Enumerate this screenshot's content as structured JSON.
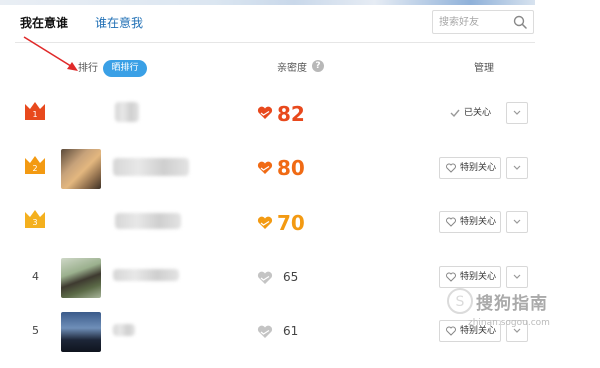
{
  "tabs": {
    "active": "我在意谁",
    "inactive": "谁在意我"
  },
  "search": {
    "placeholder": "搜索好友"
  },
  "header": {
    "rank_label": "排行",
    "rank_button": "晒排行",
    "intimacy_label": "亲密度",
    "manage_label": "管理"
  },
  "colors": {
    "gold": "#f39a12",
    "orange_red": "#e8491d",
    "blue": "#3aa0e6",
    "orange": "#f06a14"
  },
  "rows": [
    {
      "rank": "1",
      "score": "82",
      "score_color": "#e8491d",
      "action": "已关心",
      "icon": "crown-icon"
    },
    {
      "rank": "2",
      "score": "80",
      "score_color": "#f06a14",
      "action": "特别关心",
      "icon": "crown-icon"
    },
    {
      "rank": "3",
      "score": "70",
      "score_color": "#f39a12",
      "action": "特别关心",
      "icon": "crown-icon"
    },
    {
      "rank": "4",
      "score": "65",
      "action": "特别关心"
    },
    {
      "rank": "5",
      "score": "61",
      "action": "特别关心"
    }
  ],
  "watermark": {
    "text": "搜狗指南",
    "url": "zhinan.sogou.com"
  }
}
